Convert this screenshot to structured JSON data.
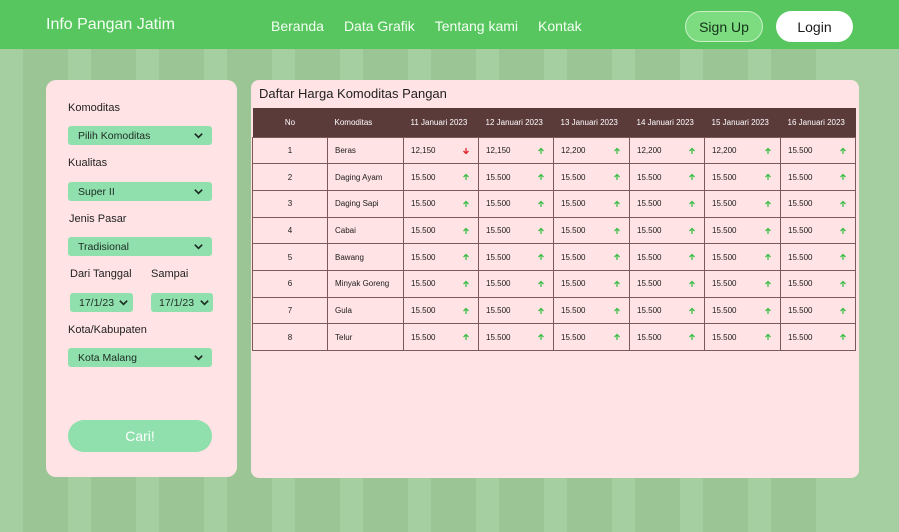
{
  "header": {
    "brand": "Info Pangan Jatim",
    "nav": [
      "Beranda",
      "Data Grafik",
      "Tentang kami",
      "Kontak"
    ],
    "signup": "Sign Up",
    "login": "Login"
  },
  "filters": {
    "komoditas_label": "Komoditas",
    "komoditas_value": "Pilih Komoditas",
    "kualitas_label": "Kualitas",
    "kualitas_value": "Super II",
    "pasar_label": "Jenis Pasar",
    "pasar_value": "Tradisional",
    "dari_label": "Dari Tanggal",
    "sampai_label": "Sampai",
    "dari_value": "17/1/23",
    "sampai_value": "17/1/23",
    "kota_label": "Kota/Kabupaten",
    "kota_value": "Kota Malang",
    "cari": "Cari!"
  },
  "table": {
    "title": "Daftar Harga Komoditas Pangan",
    "headers": [
      "No",
      "Komoditas",
      "11 Januari 2023",
      "12 Januari 2023",
      "13 Januari 2023",
      "14 Januari 2023",
      "15 Januari 2023",
      "16 Januari 2023"
    ],
    "rows": [
      {
        "no": "1",
        "name": "Beras",
        "vals": [
          "12,150",
          "12,150",
          "12,200",
          "12,200",
          "12,200",
          "15.500"
        ],
        "trend": [
          "down",
          "up",
          "up",
          "up",
          "up",
          "up"
        ]
      },
      {
        "no": "2",
        "name": "Daging Ayam",
        "vals": [
          "15.500",
          "15.500",
          "15.500",
          "15.500",
          "15.500",
          "15.500"
        ],
        "trend": [
          "up",
          "up",
          "up",
          "up",
          "up",
          "up"
        ]
      },
      {
        "no": "3",
        "name": "Daging Sapi",
        "vals": [
          "15.500",
          "15.500",
          "15.500",
          "15.500",
          "15.500",
          "15.500"
        ],
        "trend": [
          "up",
          "up",
          "up",
          "up",
          "up",
          "up"
        ]
      },
      {
        "no": "4",
        "name": "Cabai",
        "vals": [
          "15.500",
          "15.500",
          "15.500",
          "15.500",
          "15.500",
          "15.500"
        ],
        "trend": [
          "up",
          "up",
          "up",
          "up",
          "up",
          "up"
        ]
      },
      {
        "no": "5",
        "name": "Bawang",
        "vals": [
          "15.500",
          "15.500",
          "15.500",
          "15.500",
          "15.500",
          "15.500"
        ],
        "trend": [
          "up",
          "up",
          "up",
          "up",
          "up",
          "up"
        ]
      },
      {
        "no": "6",
        "name": "Minyak Goreng",
        "vals": [
          "15.500",
          "15.500",
          "15.500",
          "15.500",
          "15.500",
          "15.500"
        ],
        "trend": [
          "up",
          "up",
          "up",
          "up",
          "up",
          "up"
        ]
      },
      {
        "no": "7",
        "name": "Gula",
        "vals": [
          "15.500",
          "15.500",
          "15.500",
          "15.500",
          "15.500",
          "15.500"
        ],
        "trend": [
          "up",
          "up",
          "up",
          "up",
          "up",
          "up"
        ]
      },
      {
        "no": "8",
        "name": "Telur",
        "vals": [
          "15.500",
          "15.500",
          "15.500",
          "15.500",
          "15.500",
          "15.500"
        ],
        "trend": [
          "up",
          "up",
          "up",
          "up",
          "up",
          "up"
        ]
      }
    ]
  },
  "colors": {
    "nav_bg": "#58c65f",
    "accent": "#8fe0ad",
    "panel": "#ffe3e5",
    "table_header": "#5b3a3a",
    "up": "#3fbf4a",
    "down": "#e0242a"
  }
}
